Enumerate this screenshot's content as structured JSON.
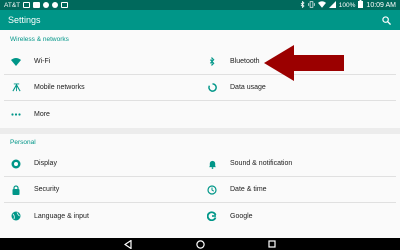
{
  "status_bar": {
    "carrier": "AT&T",
    "battery": "100%",
    "time": "10:09 AM"
  },
  "app_bar": {
    "title": "Settings",
    "search_icon": "search-icon"
  },
  "sections": {
    "wireless": {
      "header": "Wireless & networks",
      "items": [
        {
          "label": "Wi-Fi",
          "icon": "wifi-icon"
        },
        {
          "label": "Bluetooth",
          "icon": "bluetooth-icon"
        },
        {
          "label": "Mobile networks",
          "icon": "mobile-networks-icon"
        },
        {
          "label": "Data usage",
          "icon": "data-usage-icon"
        },
        {
          "label": "More",
          "icon": "more-icon"
        }
      ]
    },
    "personal": {
      "header": "Personal",
      "items": [
        {
          "label": "Display",
          "icon": "display-icon"
        },
        {
          "label": "Sound & notification",
          "icon": "bell-icon"
        },
        {
          "label": "Security",
          "icon": "lock-icon"
        },
        {
          "label": "Date & time",
          "icon": "clock-icon"
        },
        {
          "label": "Language & input",
          "icon": "globe-icon"
        },
        {
          "label": "Google",
          "icon": "google-icon"
        }
      ]
    }
  },
  "annotation": {
    "arrow_color": "#9b0000",
    "points_to": "Bluetooth"
  },
  "colors": {
    "status_bar": "#00695c",
    "app_bar": "#009688",
    "accent": "#009688",
    "icon": "#009688"
  }
}
